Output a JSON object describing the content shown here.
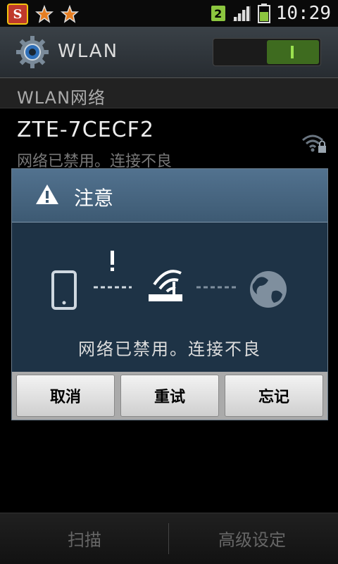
{
  "status_bar": {
    "left_icons": [
      "app-s-icon",
      "star-icon",
      "star-icon"
    ],
    "sim_badge": "2",
    "time": "10:29"
  },
  "header": {
    "title": "WLAN",
    "toggle_state": "on",
    "accent_color": "#9be24f"
  },
  "section": {
    "title": "WLAN网络"
  },
  "network": {
    "ssid": "ZTE-7CECF2",
    "status": "网络已禁用。连接不良"
  },
  "dialog": {
    "title": "注意",
    "message": "网络已禁用。连接不良",
    "buttons": {
      "cancel": "取消",
      "retry": "重试",
      "forget": "忘记"
    }
  },
  "bottom_bar": {
    "scan": "扫描",
    "advanced": "高级设定"
  }
}
